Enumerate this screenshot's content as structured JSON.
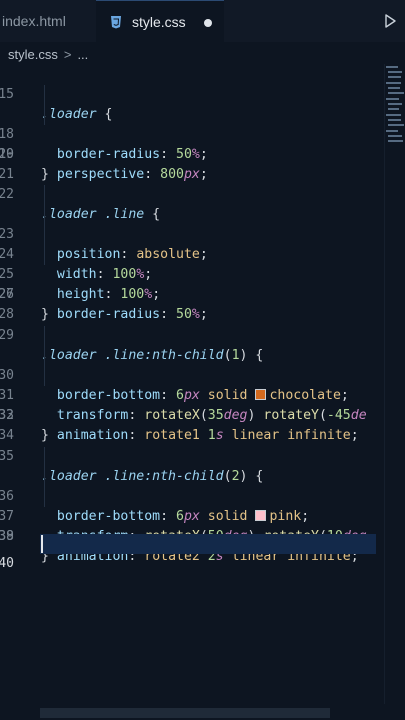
{
  "tabs": [
    {
      "label": "index.html",
      "active": false
    },
    {
      "label": "style.css",
      "active": true,
      "dirty": true
    }
  ],
  "breadcrumb": {
    "file": "style.css",
    "sep": ">",
    "more": "..."
  },
  "editor": {
    "lines": [
      {
        "n": "15",
        "text": ".loader {"
      },
      {
        "n": "18",
        "text": "  border-radius: 50%;"
      },
      {
        "n": "19",
        "text": "  perspective: 800px;"
      },
      {
        "n": "20",
        "text": "}"
      },
      {
        "n": "21",
        "text": ""
      },
      {
        "n": "22",
        "text": ".loader .line {"
      },
      {
        "n": "23",
        "text": "  position: absolute;"
      },
      {
        "n": "24",
        "text": "  width: 100%;"
      },
      {
        "n": "25",
        "text": "  height: 100%;"
      },
      {
        "n": "26",
        "text": "  border-radius: 50%;"
      },
      {
        "n": "27",
        "text": "}"
      },
      {
        "n": "28",
        "text": ""
      },
      {
        "n": "29",
        "text": ".loader .line:nth-child(1) {"
      },
      {
        "n": "30",
        "text": "  border-bottom: 6px solid chocolate;"
      },
      {
        "n": "31",
        "text": "  transform: rotateX(35deg) rotateY(-45de"
      },
      {
        "n": "32",
        "text": "  animation: rotate1 1s linear infinite;"
      },
      {
        "n": "33",
        "text": "}"
      },
      {
        "n": "34",
        "text": ""
      },
      {
        "n": "35",
        "text": ".loader .line:nth-child(2) {"
      },
      {
        "n": "36",
        "text": "  border-bottom: 6px solid pink;"
      },
      {
        "n": "37",
        "text": "  transform: rotateX(50deg) rotateY(10deg"
      },
      {
        "n": "38",
        "text": "  animation: rotate2 2s linear infinite;"
      },
      {
        "n": "39",
        "text": "}"
      },
      {
        "n": "40",
        "text": ""
      }
    ],
    "swatch_colors": {
      "chocolate": "#d2691e",
      "pink": "#ffc0cb"
    },
    "accent": "#13294a"
  }
}
